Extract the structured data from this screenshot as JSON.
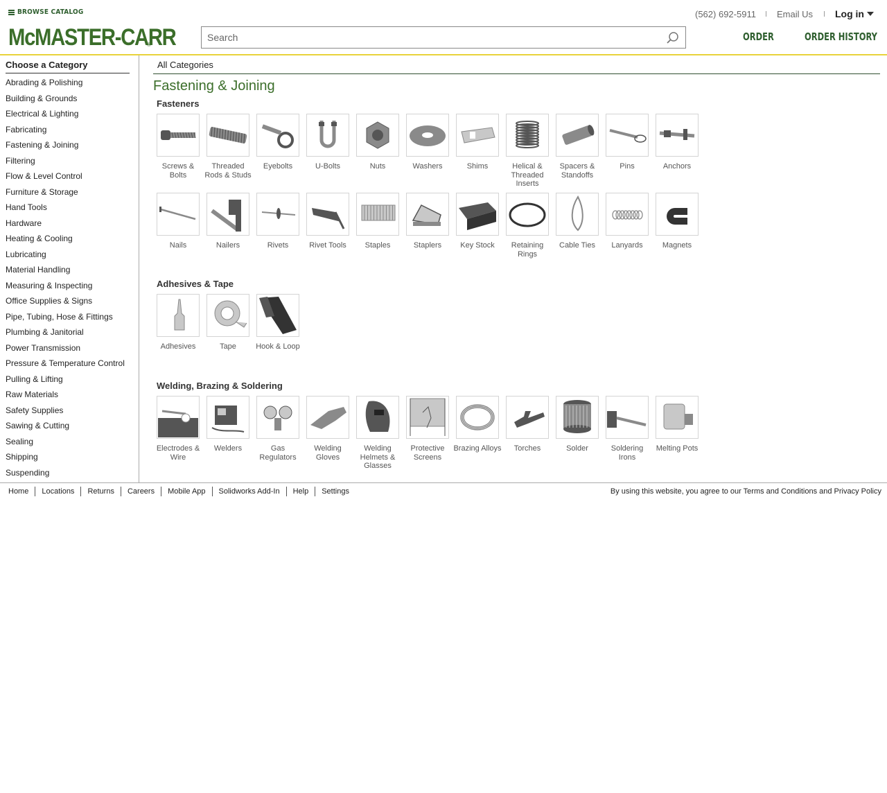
{
  "header": {
    "browse_catalog": "BROWSE CATALOG",
    "logo": "McMASTER-CARR",
    "logo_reg": "®",
    "search_placeholder": "Search",
    "phone": "(562) 692-5911",
    "email": "Email Us",
    "login": "Log in",
    "order": "ORDER",
    "order_history": "ORDER HISTORY"
  },
  "sidebar": {
    "title": "Choose a Category",
    "items": [
      "Abrading & Polishing",
      "Building & Grounds",
      "Electrical & Lighting",
      "Fabricating",
      "Fastening & Joining",
      "Filtering",
      "Flow & Level Control",
      "Furniture & Storage",
      "Hand Tools",
      "Hardware",
      "Heating & Cooling",
      "Lubricating",
      "Material Handling",
      "Measuring & Inspecting",
      "Office Supplies & Signs",
      "Pipe, Tubing, Hose & Fittings",
      "Plumbing & Janitorial",
      "Power Transmission",
      "Pressure & Temperature Control",
      "Pulling & Lifting",
      "Raw Materials",
      "Safety Supplies",
      "Sawing & Cutting",
      "Sealing",
      "Shipping",
      "Suspending"
    ]
  },
  "main": {
    "breadcrumb": "All Categories",
    "title": "Fastening & Joining",
    "sections": [
      {
        "title": "Fasteners",
        "items": [
          {
            "label": "Screws & Bolts",
            "icon": "screw-icon"
          },
          {
            "label": "Threaded Rods & Studs",
            "icon": "threaded-rod-icon"
          },
          {
            "label": "Eyebolts",
            "icon": "eyebolt-icon"
          },
          {
            "label": "U-Bolts",
            "icon": "u-bolt-icon"
          },
          {
            "label": "Nuts",
            "icon": "nut-icon"
          },
          {
            "label": "Washers",
            "icon": "washer-icon"
          },
          {
            "label": "Shims",
            "icon": "shim-icon"
          },
          {
            "label": "Helical & Threaded Inserts",
            "icon": "helical-insert-icon"
          },
          {
            "label": "Spacers & Standoffs",
            "icon": "spacer-icon"
          },
          {
            "label": "Pins",
            "icon": "pin-icon"
          },
          {
            "label": "Anchors",
            "icon": "anchor-icon"
          },
          {
            "label": "Nails",
            "icon": "nail-icon"
          },
          {
            "label": "Nailers",
            "icon": "nailer-icon"
          },
          {
            "label": "Rivets",
            "icon": "rivet-icon"
          },
          {
            "label": "Rivet Tools",
            "icon": "rivet-tool-icon"
          },
          {
            "label": "Staples",
            "icon": "staples-icon"
          },
          {
            "label": "Staplers",
            "icon": "stapler-icon"
          },
          {
            "label": "Key Stock",
            "icon": "key-stock-icon"
          },
          {
            "label": "Retaining Rings",
            "icon": "retaining-ring-icon"
          },
          {
            "label": "Cable Ties",
            "icon": "cable-tie-icon"
          },
          {
            "label": "Lanyards",
            "icon": "lanyard-icon"
          },
          {
            "label": "Magnets",
            "icon": "magnet-icon"
          }
        ]
      },
      {
        "title": "Adhesives & Tape",
        "items": [
          {
            "label": "Adhesives",
            "icon": "adhesive-bottle-icon"
          },
          {
            "label": "Tape",
            "icon": "tape-roll-icon"
          },
          {
            "label": "Hook & Loop",
            "icon": "hook-loop-icon"
          }
        ]
      },
      {
        "title": "Welding, Brazing & Soldering",
        "items": [
          {
            "label": "Electrodes & Wire",
            "icon": "electrode-icon"
          },
          {
            "label": "Welders",
            "icon": "welder-icon"
          },
          {
            "label": "Gas Regulators",
            "icon": "gas-regulator-icon"
          },
          {
            "label": "Welding Gloves",
            "icon": "welding-glove-icon"
          },
          {
            "label": "Welding Helmets & Glasses",
            "icon": "welding-helmet-icon"
          },
          {
            "label": "Protective Screens",
            "icon": "protective-screen-icon"
          },
          {
            "label": "Brazing Alloys",
            "icon": "brazing-alloy-icon"
          },
          {
            "label": "Torches",
            "icon": "torch-icon"
          },
          {
            "label": "Solder",
            "icon": "solder-spool-icon"
          },
          {
            "label": "Soldering Irons",
            "icon": "soldering-iron-icon"
          },
          {
            "label": "Melting Pots",
            "icon": "melting-pot-icon"
          }
        ]
      }
    ]
  },
  "footer": {
    "links": [
      "Home",
      "Locations",
      "Returns",
      "Careers",
      "Mobile App",
      "Solidworks Add-In",
      "Help",
      "Settings"
    ],
    "legal": "By using this website, you agree to our Terms and Conditions and Privacy Policy"
  },
  "colors": {
    "brand_green": "#3b6e2a",
    "header_rule": "#e8d23a"
  }
}
